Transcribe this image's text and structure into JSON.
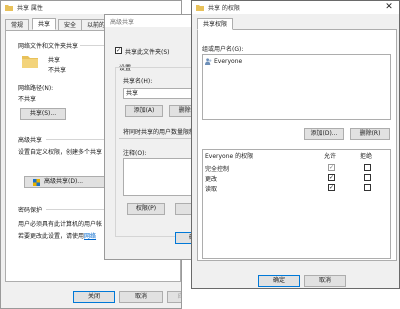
{
  "props": {
    "title": "共享 属性",
    "tabs": [
      "常规",
      "共享",
      "安全",
      "以前的版本"
    ],
    "net_group": "网络文件和文件夹共享",
    "folder_name": "共享",
    "folder_state": "不共享",
    "net_path_label": "网络路径(N):",
    "net_path_value": "不共享",
    "share_button": "共享(S)...",
    "adv_group": "高级共享",
    "adv_desc": "设置自定义权限，创建多个共享",
    "adv_button": "高级共享(D)...",
    "pwd_group": "密码保护",
    "pwd_desc_1": "用户必须具有此计算机的用户帐",
    "pwd_desc_2": "若要更改此设置，请使用",
    "pwd_link": "网络",
    "close_button": "关闭",
    "cancel_button": "取消",
    "apply_button": "应用(A)"
  },
  "adv": {
    "title": "高级共享",
    "share_checkbox": "共享此文件夹(S)",
    "settings": "设置",
    "share_name_label": "共享名(H):",
    "share_name_value": "共享",
    "add_button": "添加(A)",
    "remove_button": "删除(R)",
    "limit_label": "将同时共享的用户数量限制",
    "notes_label": "注释(O):",
    "perm_button": "权限(P)",
    "ok_button": "确定"
  },
  "perm": {
    "title": "共享 的权限",
    "tab": "共享权限",
    "group_label": "组或用户名(G):",
    "users": [
      "Everyone"
    ],
    "add_button": "添加(D)...",
    "remove_button": "删除(R)",
    "perm_header": "Everyone 的权限",
    "allow_header": "允许",
    "deny_header": "拒绝",
    "rows": [
      {
        "name": "完全控制",
        "allow": true,
        "deny": false,
        "allow_disabled": true
      },
      {
        "name": "更改",
        "allow": true,
        "deny": false,
        "allow_disabled": false
      },
      {
        "name": "读取",
        "allow": true,
        "deny": false,
        "allow_disabled": false
      }
    ],
    "ok_button": "确定",
    "cancel_button": "取消"
  },
  "icons": {
    "folder": "folder-icon",
    "shield": "shield-icon",
    "users": "users-icon",
    "close": "close-icon"
  },
  "colors": {
    "folder": "#e8c15a",
    "link": "#0066cc",
    "accent": "#0078d7"
  }
}
